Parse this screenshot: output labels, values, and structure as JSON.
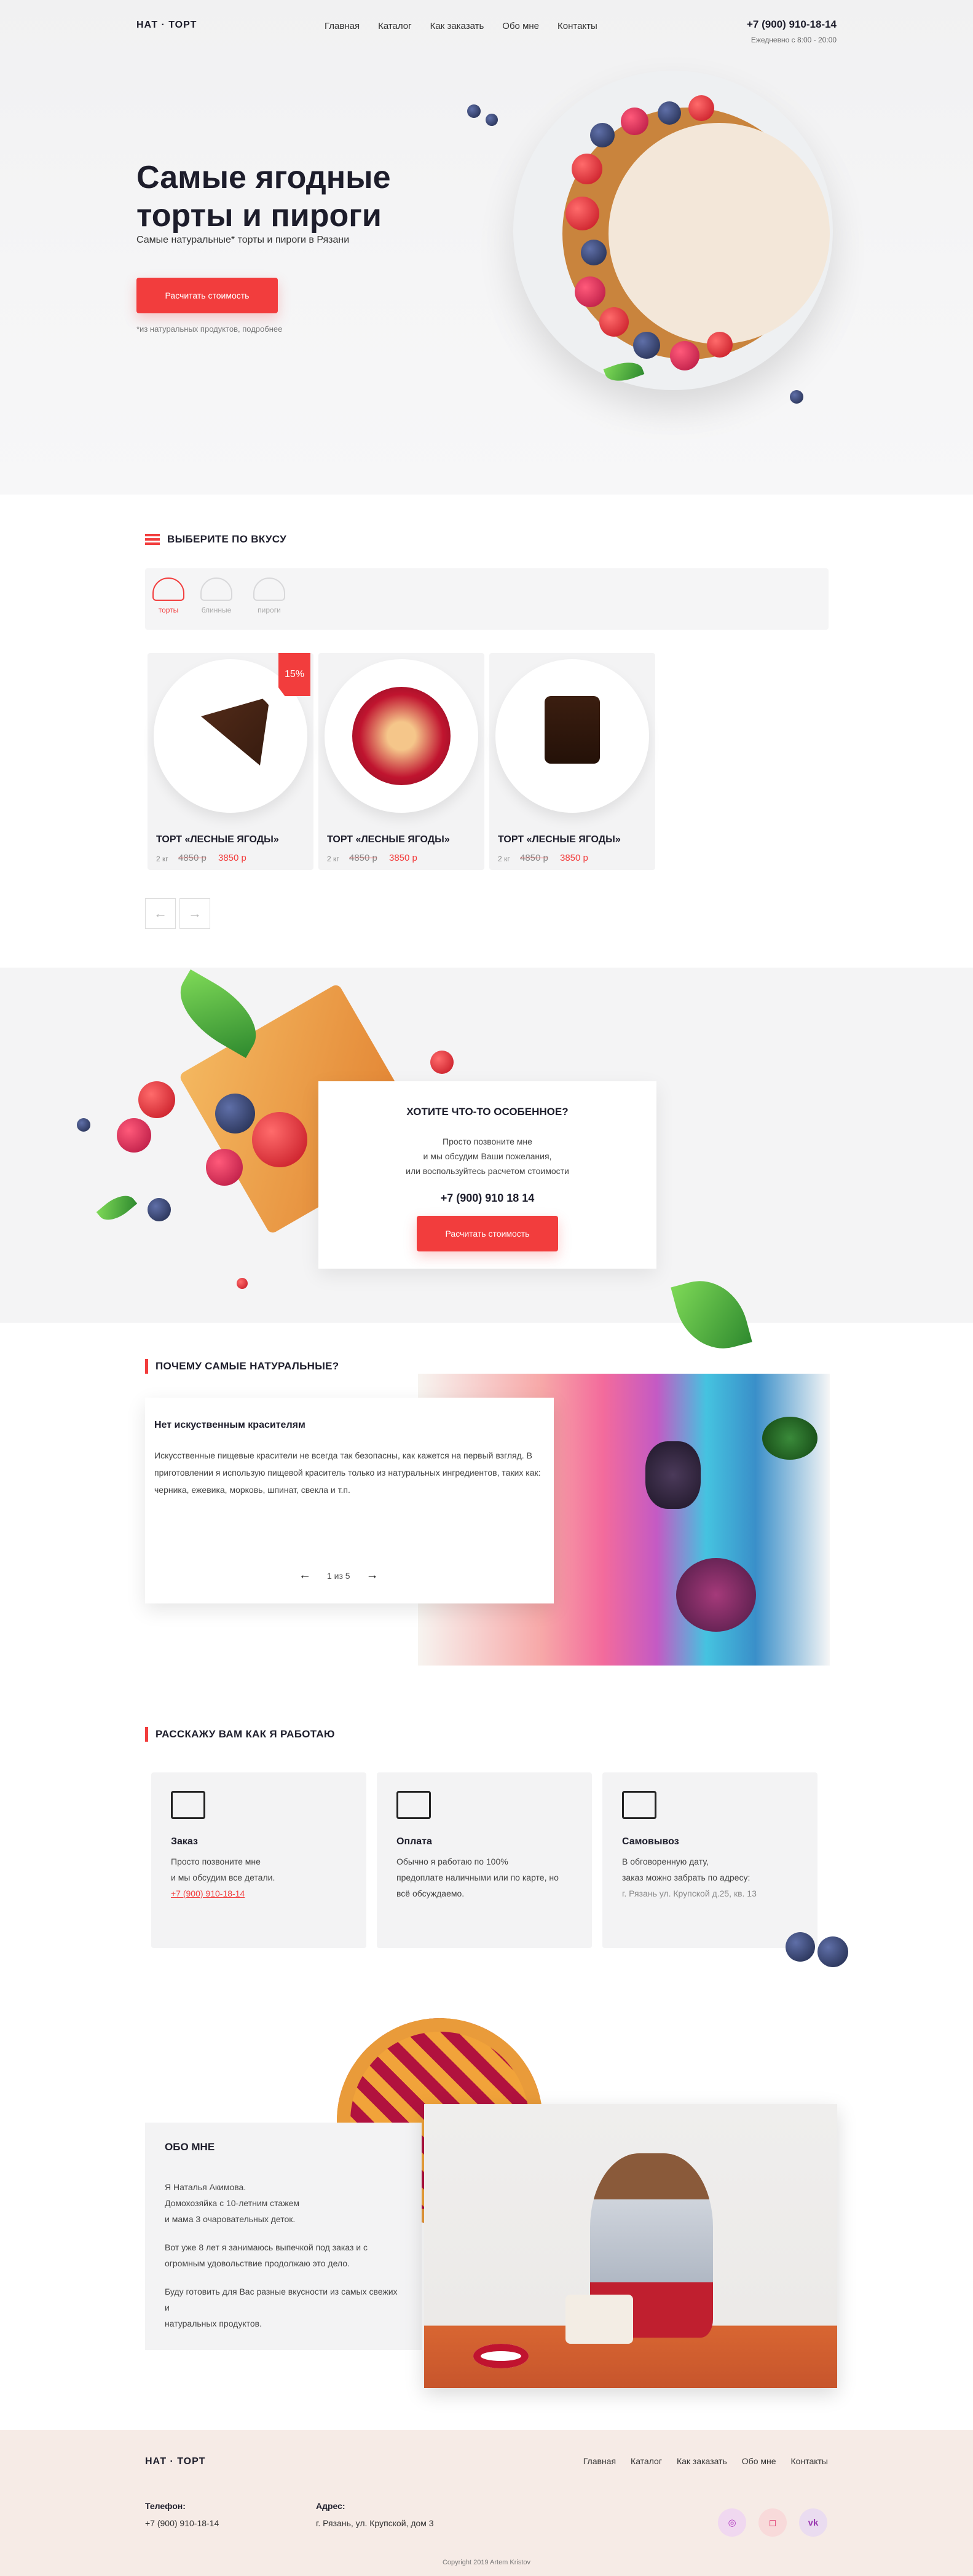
{
  "header": {
    "logo": "НАТ · ТОРТ",
    "nav": [
      "Главная",
      "Каталог",
      "Как заказать",
      "Обо мне",
      "Контакты"
    ],
    "phone": "+7 (900) 910-18-14",
    "hours": "Ежедневно с 8:00 - 20:00"
  },
  "hero": {
    "title": "Самые ягодные торты и пироги",
    "subtitle": "Самые натуральные* торты и пироги в Рязани",
    "button": "Расчитать стоимость",
    "note": "*из натуральных продуктов, подробнее"
  },
  "taste": {
    "title": "ВЫБЕРИТЕ ПО ВКУСУ",
    "categories": [
      "торты",
      "блинные",
      "пироги"
    ],
    "cards": [
      {
        "name": "ТОРТ «ЛЕСНЫЕ ЯГОДЫ»",
        "weight": "2 кг",
        "old_price": "4850 р",
        "new_price": "3850 р",
        "badge": "15%"
      },
      {
        "name": "ТОРТ «ЛЕСНЫЕ ЯГОДЫ»",
        "weight": "2 кг",
        "old_price": "4850 р",
        "new_price": "3850 р",
        "badge": ""
      },
      {
        "name": "ТОРТ «ЛЕСНЫЕ ЯГОДЫ»",
        "weight": "2 кг",
        "old_price": "4850 р",
        "new_price": "3850 р",
        "badge": ""
      }
    ],
    "prev": "←",
    "next": "→"
  },
  "special": {
    "title": "ХОТИТЕ ЧТО-ТО ОСОБЕННОЕ?",
    "line1": "Просто позвоните мне",
    "line2": "и мы обсудим Ваши пожелания,",
    "line3": "или воспользуйтесь расчетом стоимости",
    "phone": "+7 (900) 910 18 14",
    "button": "Расчитать стоимость"
  },
  "natural": {
    "title": "ПОЧЕМУ САМЫЕ НАТУРАЛЬНЫЕ?",
    "card_title": "Нет искуственным красителям",
    "card_text": "Искусственные пищевые красители не всегда так безопасны, как кажется на первый взгляд. В приготовлении я использую пищевой краситель только из натуральных ингредиентов, таких как: черника, ежевика, морковь, шпинат, свекла и т.п.",
    "pager": "1 из 5",
    "prev": "←",
    "next": "→"
  },
  "work": {
    "title": "РАССКАЖУ ВАМ КАК Я РАБОТАЮ",
    "cards": [
      {
        "title": "Заказ",
        "l1": "Просто позвоните мне",
        "l2": "и мы обсудим все детали.",
        "l3": "+7 (900) 910-18-14"
      },
      {
        "title": "Оплата",
        "l1": "Обычно я работаю по 100%",
        "l2": "предоплате наличными или по карте, но",
        "l3": "всё обсуждаемо."
      },
      {
        "title": "Самовывоз",
        "l1": "В обговоренную дату,",
        "l2": "заказ можно забрать по адресу:",
        "l3": "г. Рязань ул. Крупской д.25, кв. 13"
      }
    ]
  },
  "about": {
    "title": "ОБО МНЕ",
    "p1a": "Я Наталья Акимова.",
    "p1b": "Домохозяйка с 10-летним стажем",
    "p1c": "и мама 3 очаровательных деток.",
    "p2a": "Вот уже 8 лет я занимаюсь выпечкой под заказ и с",
    "p2b": "огромным удовольствие продолжаю это дело.",
    "p3a": "Буду готовить для Вас разные вкусности из самых свежих и",
    "p3b": "натуральных продуктов."
  },
  "footer": {
    "logo": "НАТ · ТОРТ",
    "nav": [
      "Главная",
      "Каталог",
      "Как заказать",
      "Обо мне",
      "Контакты"
    ],
    "phone_label": "Телефон:",
    "phone": "+7 (900) 910-18-14",
    "address_label": "Адрес:",
    "address": "г. Рязань, ул. Крупской, дом 3",
    "copyright": "Copyright 2019 Artem Kristov",
    "social": [
      "whatsapp-icon",
      "instagram-icon",
      "vk-icon"
    ]
  }
}
